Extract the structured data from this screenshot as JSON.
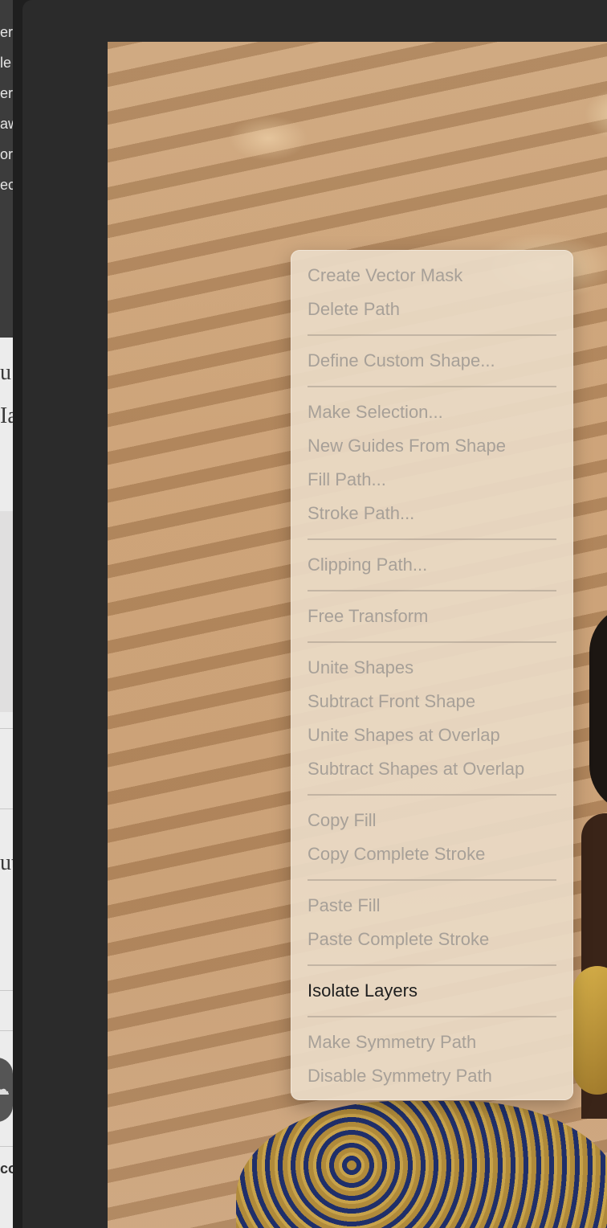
{
  "left_panel": {
    "layer_labels": [
      "er",
      "le",
      "er",
      "aw",
      "or",
      "ec"
    ],
    "serif_fragments": [
      "u",
      "Ia",
      "ut"
    ],
    "footer_fragment": "co"
  },
  "context_menu": {
    "groups": [
      [
        {
          "label": "Create Vector Mask",
          "enabled": false
        },
        {
          "label": "Delete Path",
          "enabled": false
        }
      ],
      [
        {
          "label": "Define Custom Shape...",
          "enabled": false
        }
      ],
      [
        {
          "label": "Make Selection...",
          "enabled": false
        },
        {
          "label": "New Guides From Shape",
          "enabled": false
        },
        {
          "label": "Fill Path...",
          "enabled": false
        },
        {
          "label": "Stroke Path...",
          "enabled": false
        }
      ],
      [
        {
          "label": "Clipping Path...",
          "enabled": false
        }
      ],
      [
        {
          "label": "Free Transform",
          "enabled": false
        }
      ],
      [
        {
          "label": "Unite Shapes",
          "enabled": false
        },
        {
          "label": "Subtract Front Shape",
          "enabled": false
        },
        {
          "label": "Unite Shapes at Overlap",
          "enabled": false
        },
        {
          "label": "Subtract Shapes at Overlap",
          "enabled": false
        }
      ],
      [
        {
          "label": "Copy Fill",
          "enabled": false
        },
        {
          "label": "Copy Complete Stroke",
          "enabled": false
        }
      ],
      [
        {
          "label": "Paste Fill",
          "enabled": false
        },
        {
          "label": "Paste Complete Stroke",
          "enabled": false
        }
      ],
      [
        {
          "label": "Isolate Layers",
          "enabled": true
        }
      ],
      [
        {
          "label": "Make Symmetry Path",
          "enabled": false
        },
        {
          "label": "Disable Symmetry Path",
          "enabled": false
        }
      ]
    ]
  },
  "icons": {
    "cloud": "cloud-icon"
  }
}
